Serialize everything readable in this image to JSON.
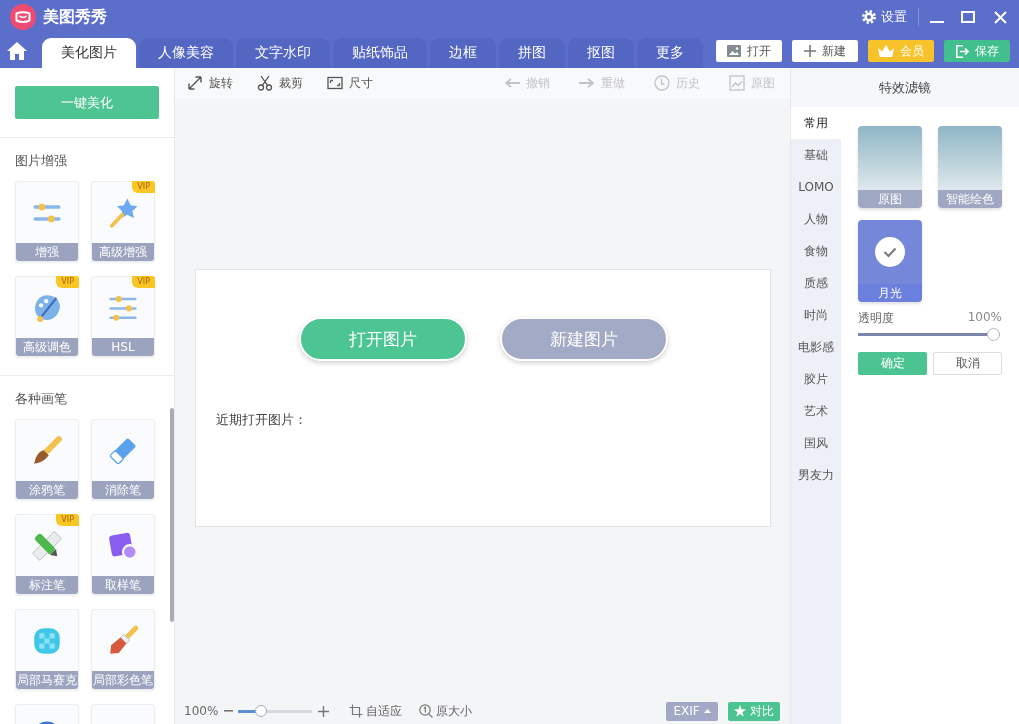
{
  "window": {
    "title": "美图秀秀",
    "settings": "设置"
  },
  "tabs": [
    {
      "label": "美化图片",
      "selected": true
    },
    {
      "label": "人像美容",
      "selected": false
    },
    {
      "label": "文字水印",
      "selected": false
    },
    {
      "label": "贴纸饰品",
      "selected": false
    },
    {
      "label": "边框",
      "selected": false
    },
    {
      "label": "拼图",
      "selected": false
    },
    {
      "label": "抠图",
      "selected": false
    },
    {
      "label": "更多",
      "selected": false
    }
  ],
  "header_buttons": [
    {
      "kind": "open",
      "label": "打开"
    },
    {
      "kind": "new",
      "label": "新建"
    },
    {
      "kind": "vip",
      "label": "会员"
    },
    {
      "kind": "save",
      "label": "保存"
    }
  ],
  "sidebar": {
    "primary_button": "一键美化",
    "sections": [
      {
        "title": "图片增强",
        "tools": [
          {
            "kind": "adjust",
            "label": "增强"
          },
          {
            "kind": "wand",
            "label": "高级增强",
            "badge": "VIP"
          },
          {
            "kind": "palette",
            "label": "高级调色",
            "badge": "VIP"
          },
          {
            "kind": "hsl",
            "label": "HSL",
            "badge": "VIP"
          }
        ]
      },
      {
        "title": "各种画笔",
        "tools": [
          {
            "kind": "brush",
            "label": "涂鸦笔"
          },
          {
            "kind": "eraser",
            "label": "消除笔"
          },
          {
            "kind": "marker",
            "label": "标注笔",
            "badge": "VIP"
          },
          {
            "kind": "picker",
            "label": "取样笔"
          },
          {
            "kind": "mosaic",
            "label": "局部马赛克"
          },
          {
            "kind": "colorbrush",
            "label": "局部彩色笔"
          },
          {
            "kind": "ring"
          },
          {
            "kind": "blob"
          }
        ]
      }
    ]
  },
  "toolbar": {
    "tools": [
      {
        "kind": "rotate",
        "label": "旋转",
        "disabled": false
      },
      {
        "kind": "crop",
        "label": "裁剪",
        "disabled": false
      },
      {
        "kind": "resize",
        "label": "尺寸",
        "disabled": false
      }
    ],
    "history": [
      {
        "kind": "undo",
        "label": "撤销",
        "disabled": true
      },
      {
        "kind": "redo",
        "label": "重做",
        "disabled": true
      },
      {
        "kind": "history",
        "label": "历史",
        "disabled": true
      },
      {
        "kind": "original",
        "label": "原图",
        "disabled": true
      }
    ]
  },
  "canvas": {
    "open_button": "打开图片",
    "new_button": "新建图片",
    "recent_label": "近期打开图片："
  },
  "status_bar": {
    "zoom_reading": "100%",
    "zoom": {
      "level": 0.27
    },
    "fit_button": "自适应",
    "actual_size_button": "原大小",
    "exif_button": "EXIF",
    "compare_button": "对比"
  },
  "filter_panel": {
    "title": "特效滤镜",
    "categories": [
      {
        "label": "常用",
        "selected": true
      },
      {
        "label": "基础",
        "selected": false
      },
      {
        "label": "LOMO",
        "selected": false
      },
      {
        "label": "人物",
        "selected": false
      },
      {
        "label": "食物",
        "selected": false
      },
      {
        "label": "质感",
        "selected": false
      },
      {
        "label": "时尚",
        "selected": false
      },
      {
        "label": "电影感",
        "selected": false
      },
      {
        "label": "胶片",
        "selected": false
      },
      {
        "label": "艺术",
        "selected": false
      },
      {
        "label": "国风",
        "selected": false
      },
      {
        "label": "男友力",
        "selected": false
      }
    ],
    "filters": [
      {
        "label": "原图",
        "selected": false
      },
      {
        "label": "智能绘色",
        "selected": false
      },
      {
        "label": "月光",
        "selected": true
      }
    ],
    "opacity": {
      "label": "透明度",
      "reading": "100%",
      "level": 1
    },
    "confirm_button": "确定",
    "cancel_button": "取消"
  }
}
